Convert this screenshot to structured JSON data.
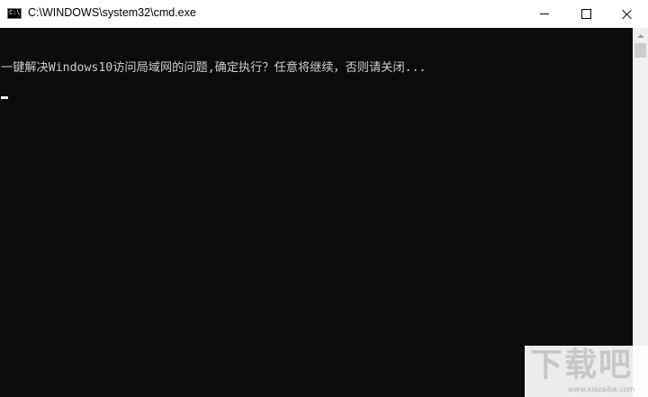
{
  "window": {
    "title": "C:\\WINDOWS\\system32\\cmd.exe",
    "icon_label": "C:\\"
  },
  "console": {
    "output_line": "一键解决Windows10访问局域网的问题,确定执行？任意将继续，否则请关闭..."
  },
  "watermark": {
    "logo_text": "下载吧",
    "url": "www.xiazaiba.com"
  },
  "colors": {
    "console_bg": "#0c0c0c",
    "console_text": "#cccccc",
    "titlebar_bg": "#ffffff"
  }
}
